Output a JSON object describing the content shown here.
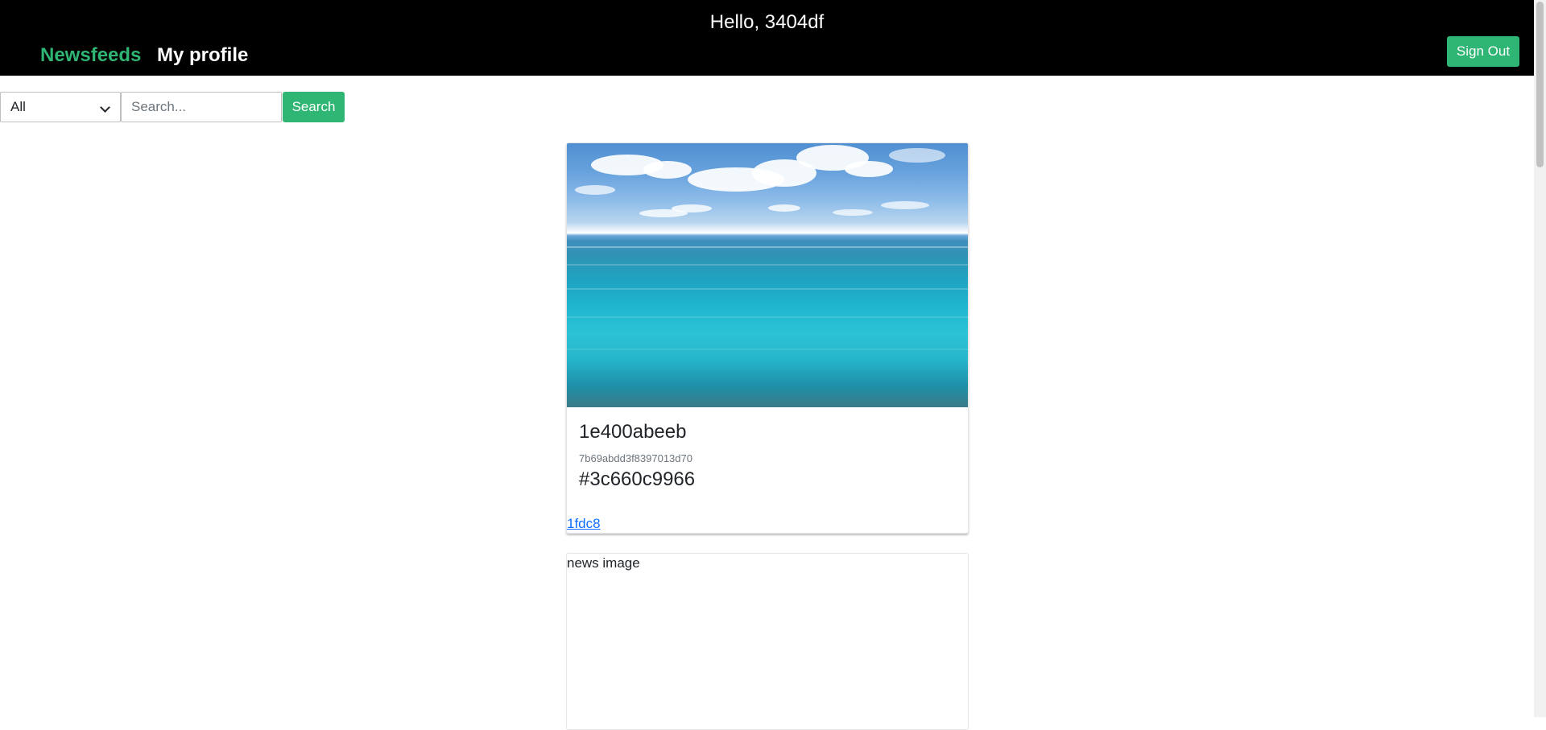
{
  "header": {
    "greeting": "Hello, 3404df",
    "nav": {
      "newsfeeds": "Newsfeeds",
      "my_profile": "My profile"
    },
    "sign_out_label": "Sign Out"
  },
  "colors": {
    "header_bg": "#000000",
    "accent": "#2fb574",
    "link": "#0d6efd"
  },
  "filter": {
    "category_selected": "All",
    "search_placeholder": "Search...",
    "search_value": "",
    "search_button": "Search"
  },
  "feed": {
    "items": [
      {
        "title": "1e400abeeb",
        "subtitle": "7b69abdd3f8397013d70",
        "tag": "#3c660c9966",
        "link": "1fdc8",
        "image": "ocean-photo"
      },
      {
        "image_alt": "news image"
      }
    ]
  }
}
